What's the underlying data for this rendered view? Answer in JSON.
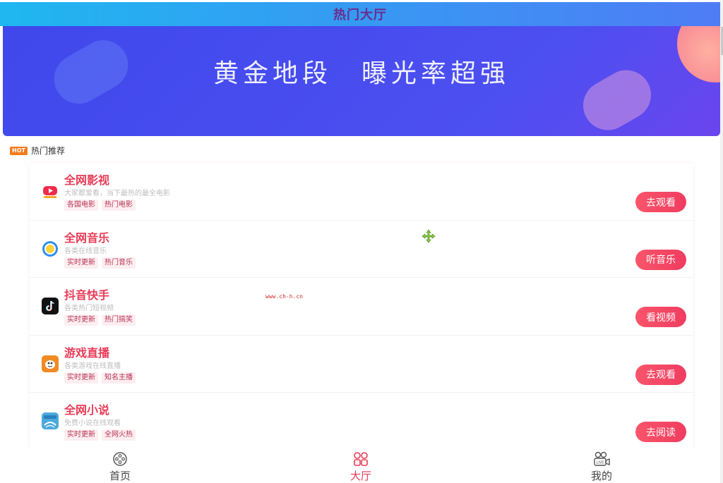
{
  "header": {
    "title": "热门大厅"
  },
  "banner": {
    "text": "黄金地段　曝光率超强"
  },
  "section": {
    "badge": "HOT",
    "title": "热门推荐"
  },
  "items": [
    {
      "title": "全网影视",
      "desc": "大家都爱看，当下最热的最全电影",
      "tags": [
        "各国电影",
        "热门电影"
      ],
      "button": "去观看",
      "icon": "video-play-icon"
    },
    {
      "title": "全网音乐",
      "desc": "各类在线音乐",
      "tags": [
        "实时更新",
        "热门音乐"
      ],
      "button": "听音乐",
      "icon": "music-disc-icon"
    },
    {
      "title": "抖音快手",
      "desc": "各类热门短视频",
      "tags": [
        "实时更新",
        "热门搞笑"
      ],
      "button": "看视频",
      "icon": "tiktok-icon"
    },
    {
      "title": "游戏直播",
      "desc": "各类游戏在线直播",
      "tags": [
        "实时更新",
        "知名主播"
      ],
      "button": "去观看",
      "icon": "game-live-icon"
    },
    {
      "title": "全网小说",
      "desc": "免费小说在线观看",
      "tags": [
        "实时更新",
        "全网火热"
      ],
      "button": "去阅读",
      "icon": "novel-book-icon"
    }
  ],
  "watermark": "www.ch-h.cn",
  "nav": [
    {
      "label": "首页",
      "icon": "film-reel-icon"
    },
    {
      "label": "大厅",
      "icon": "grid-icon"
    },
    {
      "label": "我的",
      "icon": "live-camera-icon"
    }
  ],
  "colors": {
    "accent": "#e83c57",
    "header_start": "#1fb7f0",
    "header_end": "#4e7cf5",
    "banner": "#4349ee"
  }
}
